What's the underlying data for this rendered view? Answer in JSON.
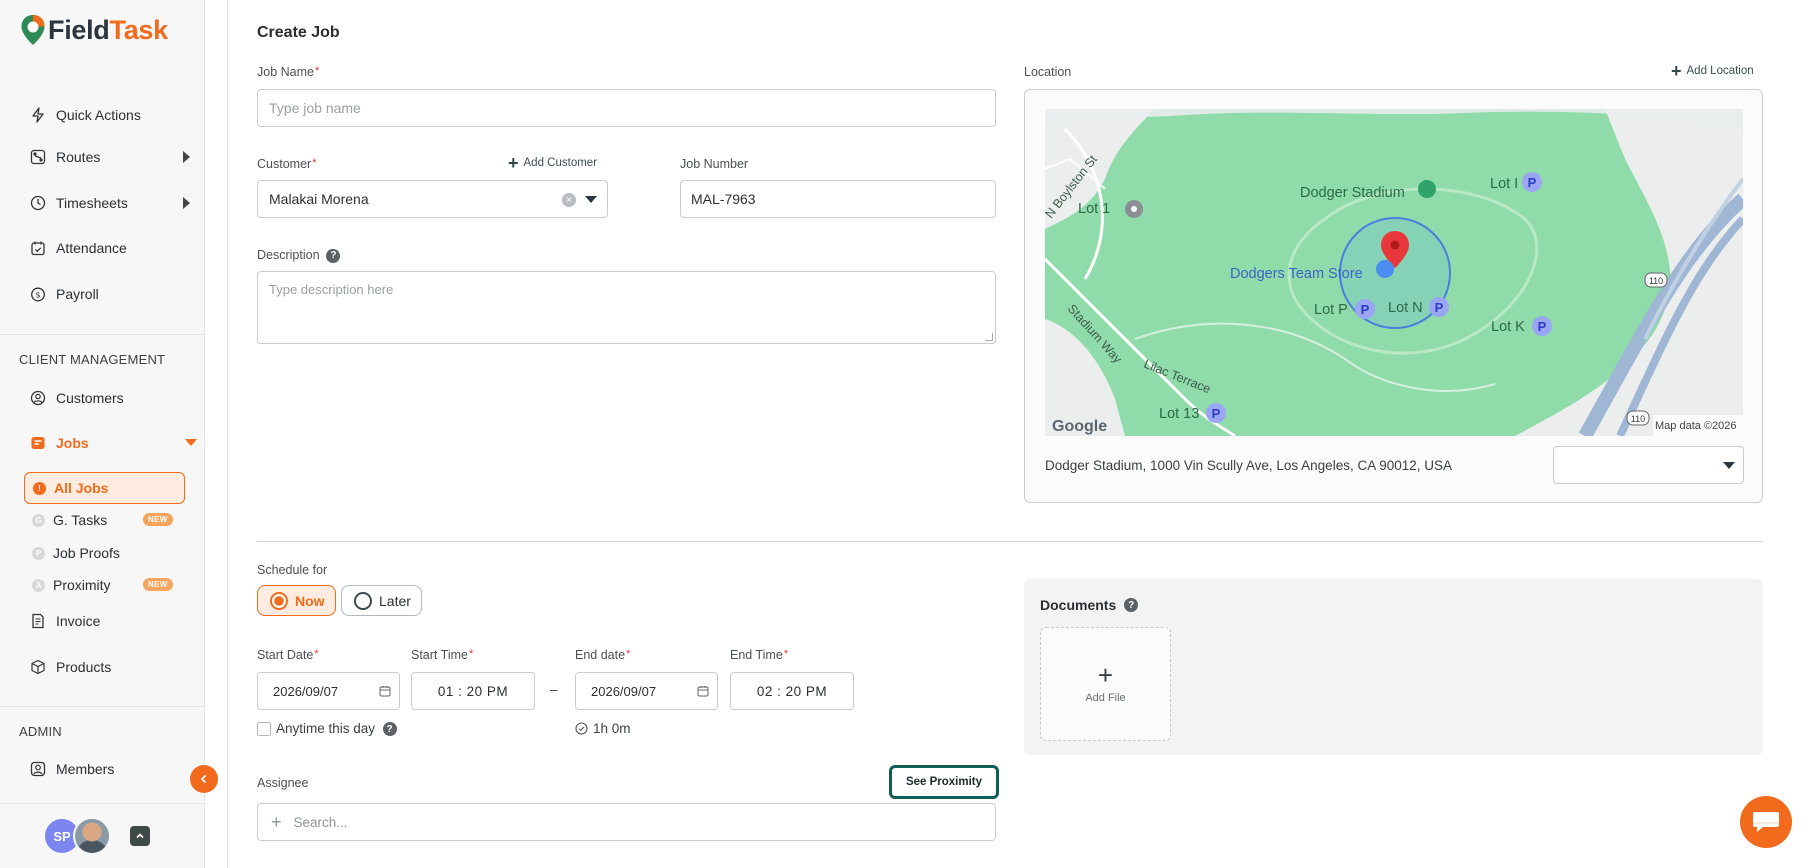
{
  "brand": {
    "name_part1": "Field",
    "name_part2": "Task"
  },
  "sidebar": {
    "items": [
      {
        "label": "Quick Actions"
      },
      {
        "label": "Routes"
      },
      {
        "label": "Timesheets"
      },
      {
        "label": "Attendance"
      },
      {
        "label": "Payroll"
      }
    ],
    "client_section": "CLIENT MANAGEMENT",
    "customers": "Customers",
    "jobs": "Jobs",
    "jobs_sub": [
      {
        "label": "All Jobs",
        "letter": "!"
      },
      {
        "label": "G. Tasks",
        "letter": "G",
        "badge": "NEW"
      },
      {
        "label": "Job Proofs",
        "letter": "P"
      },
      {
        "label": "Proximity",
        "letter": "A",
        "badge": "NEW"
      }
    ],
    "invoice": "Invoice",
    "products": "Products",
    "admin_section": "ADMIN",
    "members": "Members",
    "user_initials": "SP"
  },
  "form": {
    "title": "Create Job",
    "job_name_label": "Job Name",
    "job_name_placeholder": "Type job name",
    "customer_label": "Customer",
    "add_customer": "Add Customer",
    "customer_value": "Malakai Morena",
    "job_number_label": "Job Number",
    "job_number_value": "MAL-7963",
    "description_label": "Description",
    "description_placeholder": "Type description here",
    "location_label": "Location",
    "add_location": "Add Location",
    "address": "Dodger Stadium, 1000 Vin Scully Ave, Los Angeles, CA 90012, USA",
    "map": {
      "attribution": "Map data ©2026",
      "logo": "Google",
      "labels": {
        "stadium": "Dodger Stadium",
        "store": "Dodgers Team Store",
        "lot_i": "Lot I",
        "lot_1": "Lot 1",
        "lot_p": "Lot P",
        "lot_n": "Lot N",
        "lot_k": "Lot K",
        "lot_13": "Lot 13",
        "n_boylston": "N Boylston St",
        "stadium_way": "Stadium Way",
        "lilac": "Lilac Terrace",
        "hwy": "110"
      }
    },
    "schedule_label": "Schedule for",
    "schedule_now": "Now",
    "schedule_later": "Later",
    "start_date_label": "Start Date",
    "start_date": "2026/09/07",
    "start_time_label": "Start Time",
    "start_time": "01 : 20  PM",
    "dash": "–",
    "end_date_label": "End date",
    "end_date": "2026/09/07",
    "end_time_label": "End Time",
    "end_time": "02 : 20  PM",
    "anytime_label": "Anytime this day",
    "duration": "1h 0m",
    "assignee_label": "Assignee",
    "see_proximity": "See Proximity",
    "assignee_placeholder": "Search...",
    "documents_label": "Documents",
    "add_file": "Add File"
  },
  "colors": {
    "brand_orange": "#f26a1b",
    "map_green": "#8fdcaa",
    "proximity_border": "#0f5e55"
  },
  "icons": [
    "bolt-icon",
    "route-icon",
    "clock-icon",
    "calendar-check-icon",
    "payroll-icon",
    "user-circle-icon",
    "jobs-icon",
    "invoice-icon",
    "box-icon",
    "members-icon",
    "help-icon",
    "calendar-icon",
    "chat-icon"
  ]
}
